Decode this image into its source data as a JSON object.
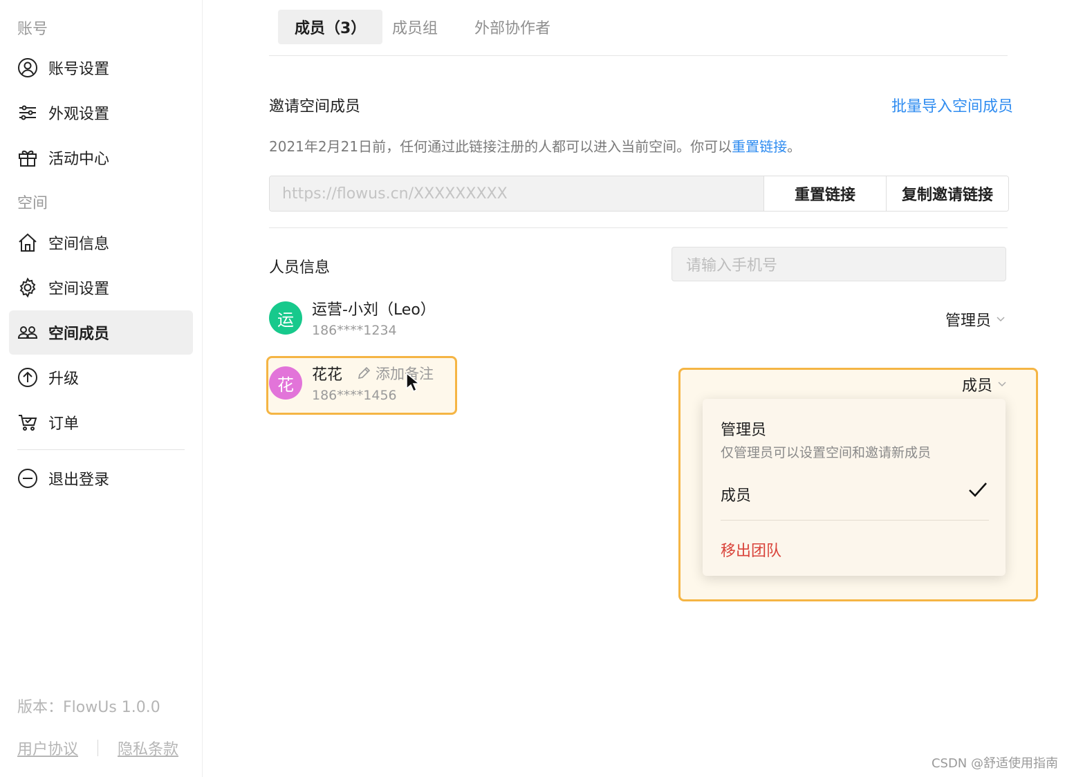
{
  "sidebar": {
    "section_account": "账号",
    "section_space": "空间",
    "items": [
      {
        "label": "账号设置",
        "icon": "user-circle-icon"
      },
      {
        "label": "外观设置",
        "icon": "sliders-icon"
      },
      {
        "label": "活动中心",
        "icon": "gift-icon"
      },
      {
        "label": "空间信息",
        "icon": "home-icon"
      },
      {
        "label": "空间设置",
        "icon": "gear-icon"
      },
      {
        "label": "空间成员",
        "icon": "users-icon",
        "active": true
      },
      {
        "label": "升级",
        "icon": "arrow-up-circle-icon"
      },
      {
        "label": "订单",
        "icon": "cart-icon"
      },
      {
        "label": "退出登录",
        "icon": "minus-circle-icon"
      }
    ],
    "version": "版本：FlowUs 1.0.0",
    "user_agreement": "用户协议",
    "privacy": "隐私条款"
  },
  "tabs": [
    {
      "label": "成员（3）",
      "active": true
    },
    {
      "label": "成员组"
    },
    {
      "label": "外部协作者"
    }
  ],
  "invite": {
    "title": "邀请空间成员",
    "bulk_import": "批量导入空间成员",
    "desc_prefix": "2021年2月21日前，任何通过此链接注册的人都可以进入当前空间。你可以",
    "desc_link": "重置链接",
    "desc_suffix": "。",
    "url_placeholder": "https://flowus.cn/XXXXXXXXX",
    "reset_button": "重置链接",
    "copy_button": "复制邀请链接"
  },
  "members": {
    "title": "人员信息",
    "search_placeholder": "请输入手机号",
    "list": [
      {
        "avatar": "运",
        "name": "运营-小刘（Leo）",
        "phone": "186****1234",
        "role": "管理员",
        "color": "#17c98c"
      },
      {
        "avatar": "花",
        "name": "花花",
        "phone": "186****1456",
        "role": "成员",
        "color": "#e274d9",
        "note_action": "添加备注"
      }
    ]
  },
  "role_menu": {
    "admin_title": "管理员",
    "admin_desc": "仅管理员可以设置空间和邀请新成员",
    "member_title": "成员",
    "remove": "移出团队"
  },
  "colors": {
    "accent": "#2f8cf0",
    "highlight": "#f5b544",
    "danger": "#d9433a"
  },
  "watermark": "CSDN @舒适使用指南"
}
